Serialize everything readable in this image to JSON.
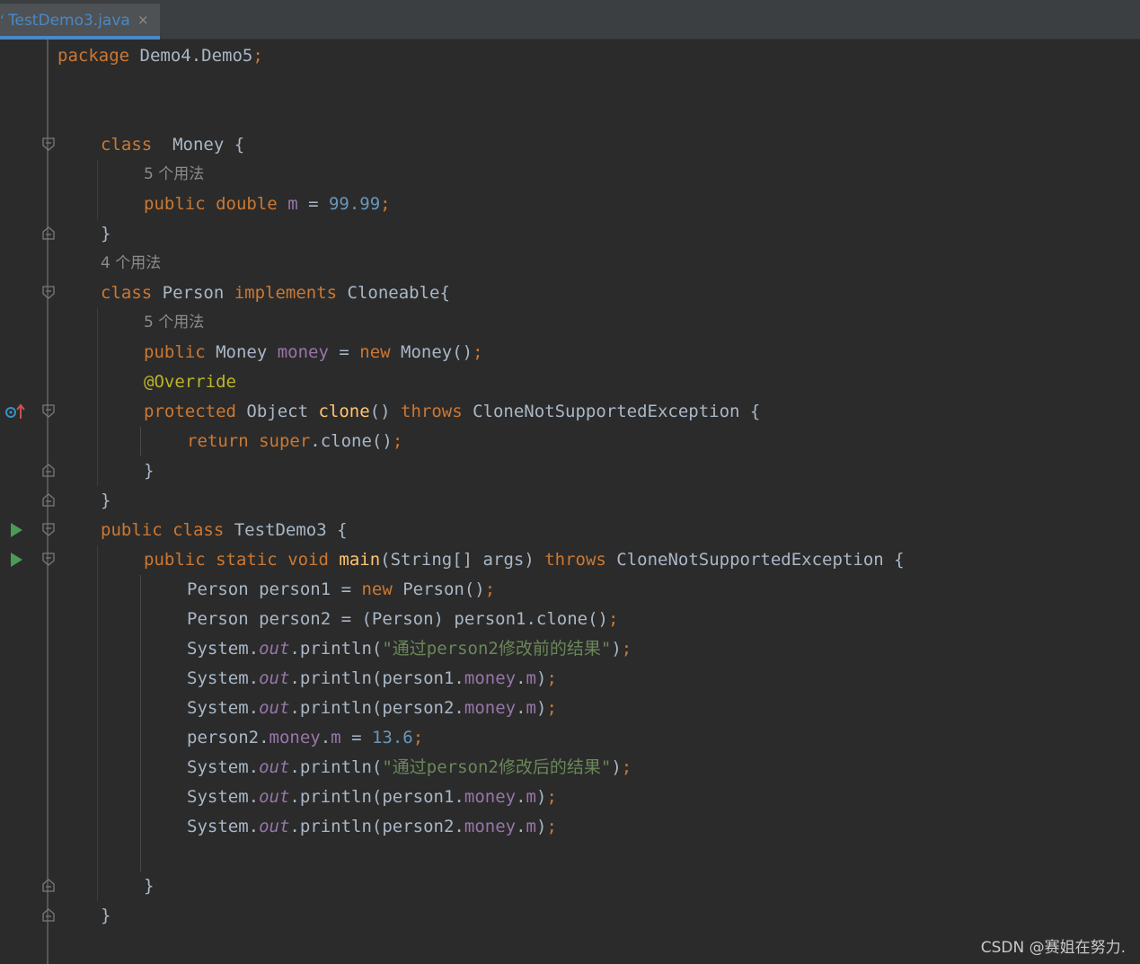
{
  "tab": {
    "label": "TestDemo3.java",
    "close": "×",
    "icon": "java-file-icon"
  },
  "hints": {
    "money_field_usages": "5 个用法",
    "person_class_usages": "4 个用法",
    "person_money_usages": "5 个用法"
  },
  "code": {
    "package_kw": "package",
    "package_name": " Demo4.Demo5",
    "semi": ";",
    "class_kw": "class",
    "money_class": "  Money {",
    "public_kw": "public",
    "double_kw": "double",
    "m_field": "m",
    "eq": " = ",
    "val_9999": "99.99",
    "close_brace": "}",
    "person_class": " Person ",
    "implements_kw": "implements",
    "cloneable": " Cloneable{",
    "money_type": " Money ",
    "money_field": "money",
    "new_kw": "new",
    "money_ctor": " Money()",
    "override": "@Override",
    "protected_kw": "protected",
    "object_type": " Object ",
    "clone_method": "clone",
    "parens": "() ",
    "throws_kw": "throws",
    "exception_brace": " CloneNotSupportedException {",
    "return_kw": "return",
    "super_kw": "super",
    "super_clone": ".clone()",
    "testdemo_class": " TestDemo3 {",
    "static_kw": "static",
    "void_kw": "void",
    "main_method": "main",
    "main_params": "(String[] args) ",
    "person1_decl": "Person person1 = ",
    "person_ctor": " Person()",
    "person2_decl": "Person person2 = (Person) person1.clone()",
    "system": "System.",
    "out": "out",
    "println_open": ".println(",
    "str_before": "\"通过person2修改前的结果\"",
    "str_after": "\"通过person2修改后的结果\"",
    "close_paren": ")",
    "person1": "person1.",
    "person2": "person2.",
    "dot": ".",
    "val_136": "13.6"
  },
  "watermark": "CSDN @赛姐在努力."
}
